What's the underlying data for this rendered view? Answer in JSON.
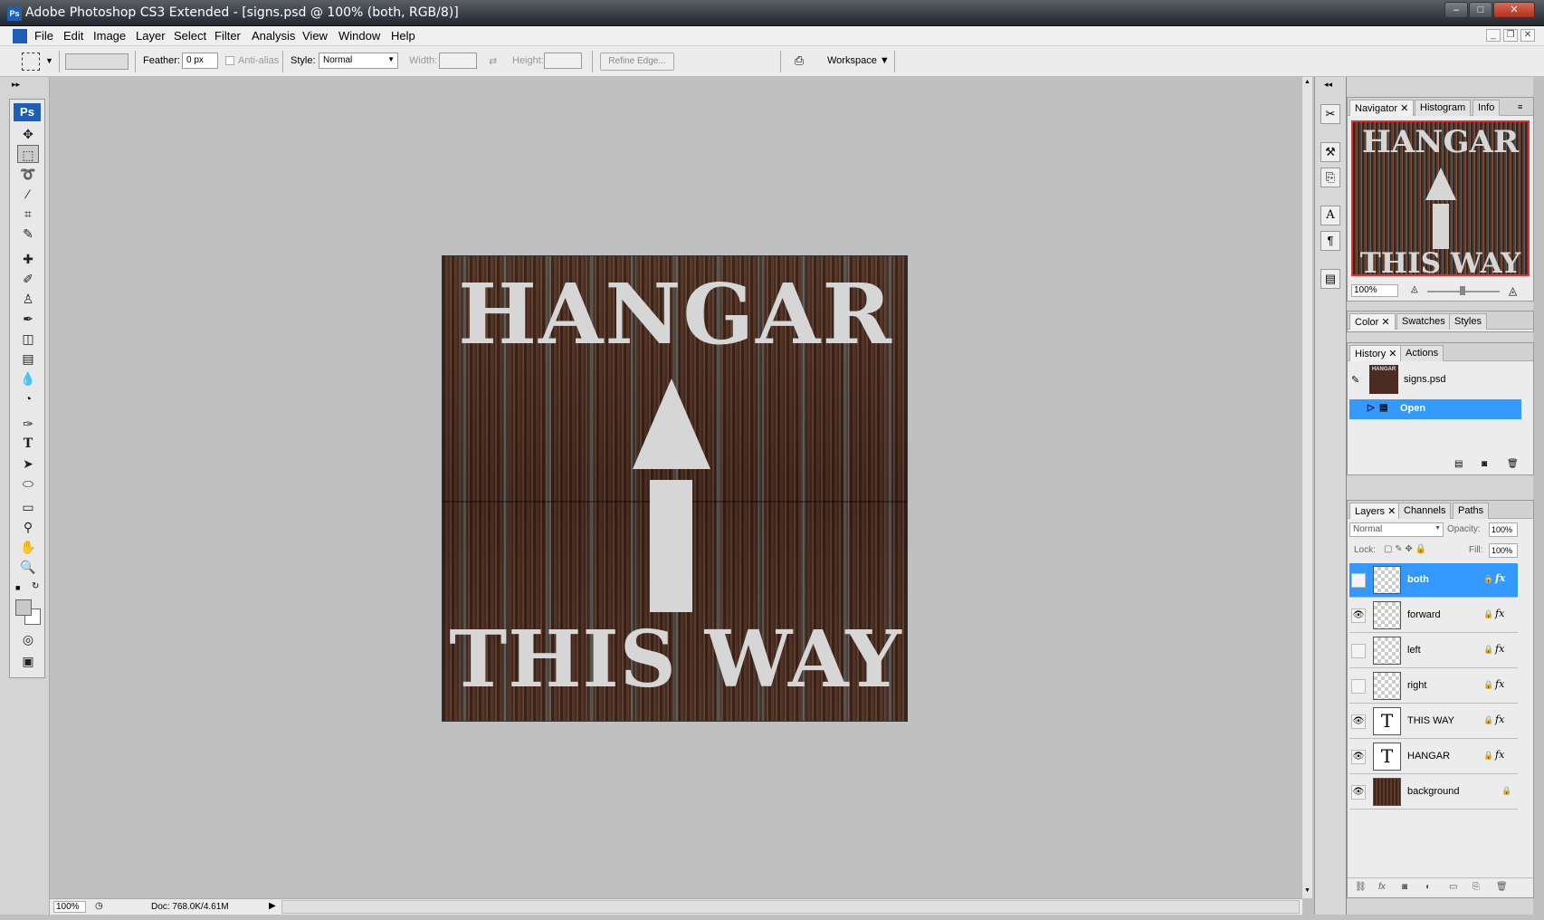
{
  "window": {
    "title": "Adobe Photoshop CS3 Extended - [signs.psd @ 100% (both, RGB/8)]",
    "app_icon": "Ps"
  },
  "menu": [
    "File",
    "Edit",
    "Image",
    "Layer",
    "Select",
    "Filter",
    "Analysis",
    "View",
    "Window",
    "Help"
  ],
  "options": {
    "feather_label": "Feather:",
    "feather_value": "0 px",
    "antialias_label": "Anti-alias",
    "style_label": "Style:",
    "style_value": "Normal",
    "width_label": "Width:",
    "height_label": "Height:",
    "refine_edge": "Refine Edge...",
    "workspace": "Workspace ▼"
  },
  "toolbox": {
    "logo": "Ps"
  },
  "canvas": {
    "top_text": "HANGAR",
    "bottom_text": "THIS WAY"
  },
  "status": {
    "zoom": "100%",
    "doc": "Doc: 768.0K/4.61M"
  },
  "navigator": {
    "tabs": [
      "Navigator",
      "Histogram",
      "Info"
    ],
    "thumb_top": "HANGAR",
    "thumb_bottom": "THIS WAY",
    "zoom": "100%"
  },
  "color_panel": {
    "tabs": [
      "Color",
      "Swatches",
      "Styles"
    ]
  },
  "history_panel": {
    "tabs": [
      "History",
      "Actions"
    ],
    "snapshot": "signs.psd",
    "snapshot_thumb": "HANGAR",
    "state": "Open"
  },
  "layers_panel": {
    "tabs": [
      "Layers",
      "Channels",
      "Paths"
    ],
    "blend_mode": "Normal",
    "opacity_label": "Opacity:",
    "opacity": "100%",
    "lock_label": "Lock:",
    "fill_label": "Fill:",
    "fill": "100%",
    "layers": [
      {
        "name": "both",
        "visible": false,
        "selected": true,
        "kind": "pixel"
      },
      {
        "name": "forward",
        "visible": true,
        "selected": false,
        "kind": "pixel"
      },
      {
        "name": "left",
        "visible": false,
        "selected": false,
        "kind": "pixel"
      },
      {
        "name": "right",
        "visible": false,
        "selected": false,
        "kind": "pixel"
      },
      {
        "name": "THIS WAY",
        "visible": true,
        "selected": false,
        "kind": "text"
      },
      {
        "name": "HANGAR",
        "visible": true,
        "selected": false,
        "kind": "text"
      },
      {
        "name": "background",
        "visible": true,
        "selected": false,
        "kind": "image"
      }
    ],
    "text_layer_thumb": "T",
    "fx": "fx"
  }
}
